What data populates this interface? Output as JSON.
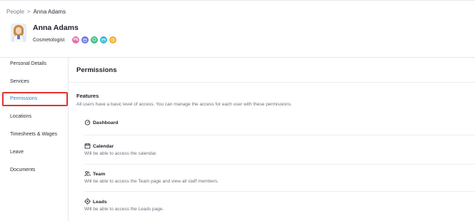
{
  "breadcrumb": {
    "parent": "People",
    "separator": ">",
    "current": "Anna Adams"
  },
  "profile": {
    "name": "Anna Adams",
    "role": "Cosmetologist",
    "badges": [
      {
        "icon": "initials-badge-icon",
        "text": "PE",
        "color": "#e26fa8"
      },
      {
        "icon": "calendar-badge-icon",
        "text": "",
        "color": "#6a78e0"
      },
      {
        "icon": "chat-badge-icon",
        "text": "",
        "color": "#3fbf85"
      },
      {
        "icon": "card-badge-icon",
        "text": "",
        "color": "#33b4d8"
      },
      {
        "icon": "clock-badge-icon",
        "text": "",
        "color": "#f2b22c"
      }
    ]
  },
  "sidebar": {
    "items": [
      {
        "label": "Personal Details"
      },
      {
        "label": "Services"
      },
      {
        "label": "Permissions"
      },
      {
        "label": "Locations"
      },
      {
        "label": "Timesheets & Wages"
      },
      {
        "label": "Leave"
      },
      {
        "label": "Documents"
      }
    ],
    "active_color": "#2d86c9",
    "highlight_color": "#e0332f"
  },
  "main": {
    "title": "Permissions",
    "features_title": "Features",
    "features_desc": "All users have a basic level of access. You can manage the access for each user with these permissions.",
    "permissions": [
      {
        "icon": "dashboard-icon",
        "title": "Dashboard",
        "desc": ""
      },
      {
        "icon": "calendar-icon",
        "title": "Calendar",
        "desc": "Will be able to access the calendar."
      },
      {
        "icon": "team-icon",
        "title": "Team",
        "desc": "Will be able to access the Team page and view all staff members."
      },
      {
        "icon": "leads-icon",
        "title": "Leads",
        "desc": "Will be able to access the Leads page."
      }
    ]
  }
}
